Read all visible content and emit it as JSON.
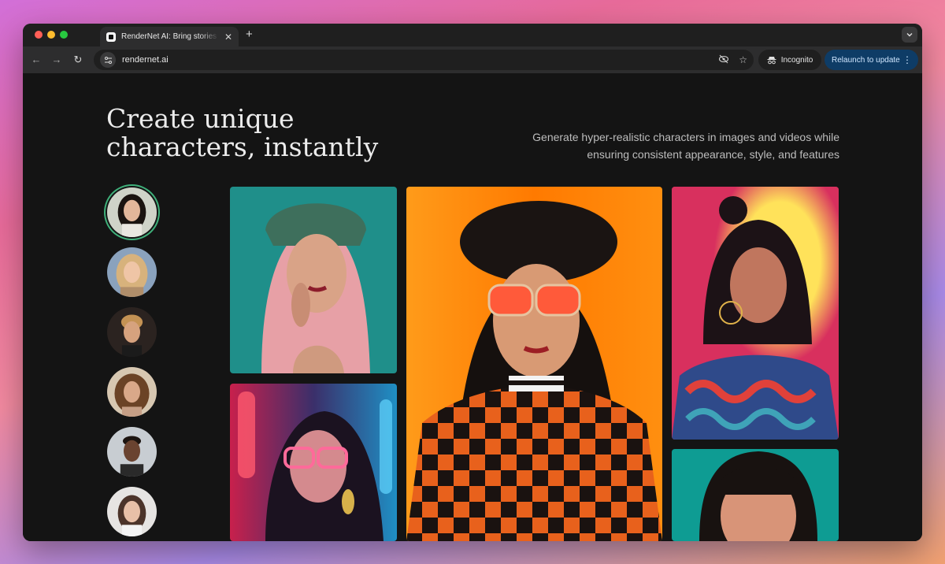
{
  "browser": {
    "tab": {
      "title": "RenderNet AI: Bring stories alive",
      "close_icon": "close-icon"
    },
    "new_tab_label": "+",
    "address": {
      "url": "rendernet.ai"
    },
    "incognito_label": "Incognito",
    "relaunch_label": "Relaunch to update"
  },
  "hero": {
    "headline": "Create unique characters, instantly",
    "subtitle": "Generate hyper-realistic characters in images and videos while ensuring consistent appearance, style, and features"
  },
  "avatars": [
    {
      "name": "avatar-1",
      "selected": true
    },
    {
      "name": "avatar-2",
      "selected": false
    },
    {
      "name": "avatar-3",
      "selected": false
    },
    {
      "name": "avatar-4",
      "selected": false
    },
    {
      "name": "avatar-5",
      "selected": false
    },
    {
      "name": "avatar-6",
      "selected": false
    }
  ],
  "colors": {
    "accent_selected": "#3fb07a",
    "relaunch_bg": "#0e3c66",
    "page_bg": "#141414"
  }
}
